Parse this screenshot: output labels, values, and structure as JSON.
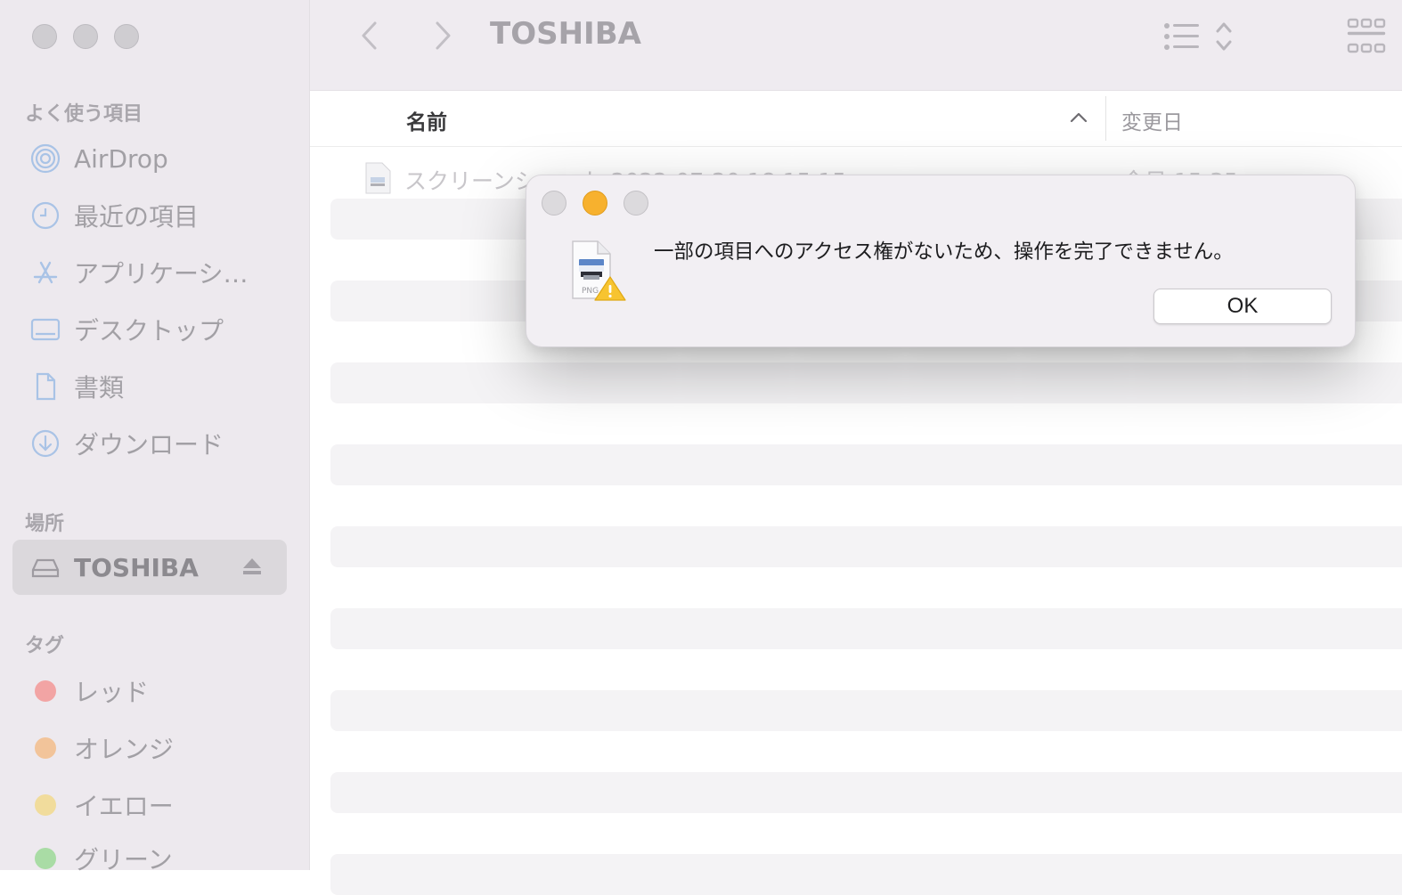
{
  "window": {
    "title": "TOSHIBA"
  },
  "sidebar": {
    "favorites_title": "よく使う項目",
    "favorites": [
      {
        "label": "AirDrop",
        "icon": "airdrop-icon"
      },
      {
        "label": "最近の項目",
        "icon": "clock-icon"
      },
      {
        "label": "アプリケーシ…",
        "icon": "applications-icon"
      },
      {
        "label": "デスクトップ",
        "icon": "desktop-icon"
      },
      {
        "label": "書類",
        "icon": "document-icon"
      },
      {
        "label": "ダウンロード",
        "icon": "download-icon"
      }
    ],
    "locations_title": "場所",
    "locations": [
      {
        "label": "TOSHIBA",
        "icon": "drive-icon",
        "selected": true
      }
    ],
    "tags_title": "タグ",
    "tags": [
      {
        "label": "レッド",
        "color": "#f2a4a4"
      },
      {
        "label": "オレンジ",
        "color": "#f2c49a"
      },
      {
        "label": "イエロー",
        "color": "#f1dc9c"
      },
      {
        "label": "グリーン",
        "color": "#a9dca5"
      }
    ]
  },
  "file_list": {
    "columns": {
      "name": "名前",
      "date_modified": "変更日"
    },
    "rows": [
      {
        "name": "スクリーンショット 2022-07-20 18.15.15",
        "date": "今日 15:35"
      }
    ]
  },
  "alert": {
    "message": "一部の項目へのアクセス権がないため、操作を完了できません。",
    "ok_label": "OK",
    "icon_badge": "PNG",
    "accent": "#f7b12e"
  }
}
